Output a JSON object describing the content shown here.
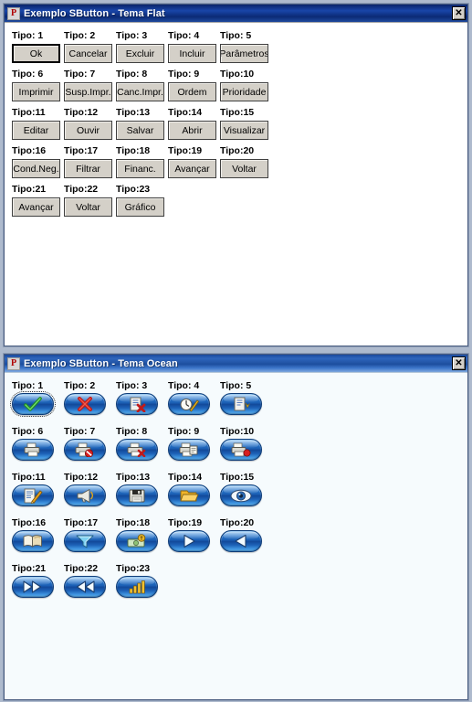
{
  "desktop": {
    "background_color": "#aebacd"
  },
  "windows": [
    {
      "id": "flat",
      "title": "Exemplo SButton - Tema Flat",
      "app_icon_glyph": "P",
      "close_label": "✕",
      "theme": "flat",
      "background_color": "#ffffff",
      "rows": [
        {
          "labels": [
            "Tipo: 1",
            "Tipo: 2",
            "Tipo: 3",
            "Tipo: 4",
            "Tipo: 5"
          ],
          "buttons": [
            "Ok",
            "Cancelar",
            "Excluir",
            "Incluir",
            "Parâmetros"
          ]
        },
        {
          "labels": [
            "Tipo: 6",
            "Tipo: 7",
            "Tipo: 8",
            "Tipo: 9",
            "Tipo:10"
          ],
          "buttons": [
            "Imprimir",
            "Susp.Impr.",
            "Canc.Impr.",
            "Ordem",
            "Prioridade"
          ]
        },
        {
          "labels": [
            "Tipo:11",
            "Tipo:12",
            "Tipo:13",
            "Tipo:14",
            "Tipo:15"
          ],
          "buttons": [
            "Editar",
            "Ouvir",
            "Salvar",
            "Abrir",
            "Visualizar"
          ]
        },
        {
          "labels": [
            "Tipo:16",
            "Tipo:17",
            "Tipo:18",
            "Tipo:19",
            "Tipo:20"
          ],
          "buttons": [
            "Cond.Neg.",
            "Filtrar",
            "Financ.",
            "Avançar",
            "Voltar"
          ]
        },
        {
          "labels": [
            "Tipo:21",
            "Tipo:22",
            "Tipo:23"
          ],
          "buttons": [
            "Avançar",
            "Voltar",
            "Gráfico"
          ]
        }
      ]
    },
    {
      "id": "ocean",
      "title": "Exemplo SButton - Tema Ocean",
      "app_icon_glyph": "P",
      "close_label": "✕",
      "theme": "ocean",
      "background_color": "#f6fbfd",
      "accent_color": "#1b5fb4",
      "rows": [
        {
          "labels": [
            "Tipo: 1",
            "Tipo: 2",
            "Tipo: 3",
            "Tipo: 4",
            "Tipo: 5"
          ],
          "icons": [
            "check-icon",
            "x-icon",
            "document-delete-icon",
            "document-edit-icon",
            "document-add-icon"
          ]
        },
        {
          "labels": [
            "Tipo: 6",
            "Tipo: 7",
            "Tipo: 8",
            "Tipo: 9",
            "Tipo:10"
          ],
          "icons": [
            "printer-icon",
            "printer-stop-icon",
            "printer-cancel-icon",
            "printer-order-icon",
            "printer-priority-icon"
          ]
        },
        {
          "labels": [
            "Tipo:11",
            "Tipo:12",
            "Tipo:13",
            "Tipo:14",
            "Tipo:15"
          ],
          "icons": [
            "edit-pencil-icon",
            "megaphone-icon",
            "floppy-save-icon",
            "open-folder-icon",
            "eye-icon"
          ]
        },
        {
          "labels": [
            "Tipo:16",
            "Tipo:17",
            "Tipo:18",
            "Tipo:19",
            "Tipo:20"
          ],
          "icons": [
            "book-icon",
            "funnel-filter-icon",
            "money-icon",
            "play-forward-icon",
            "play-back-icon"
          ]
        },
        {
          "labels": [
            "Tipo:21",
            "Tipo:22",
            "Tipo:23"
          ],
          "icons": [
            "fast-forward-icon",
            "rewind-icon",
            "bar-chart-icon"
          ]
        }
      ]
    }
  ]
}
